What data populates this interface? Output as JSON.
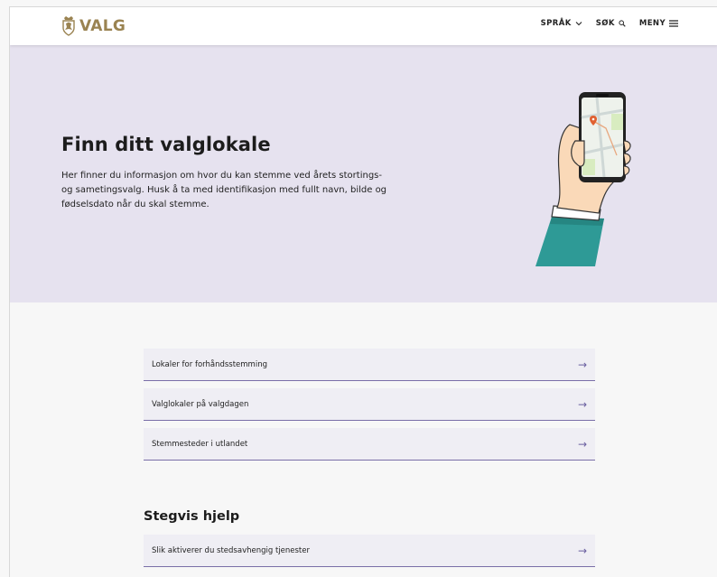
{
  "header": {
    "logo_text": "VALG",
    "nav": [
      {
        "label": "SPRÅK",
        "icon": "chevron-down-icon"
      },
      {
        "label": "SØK",
        "icon": "search-icon"
      },
      {
        "label": "MENY",
        "icon": "hamburger-icon"
      }
    ]
  },
  "hero": {
    "title": "Finn ditt valglokale",
    "text": "Her finner du informasjon om hvor du kan stemme ved årets stortings- og sametingsvalg. Husk å ta med identifikasjon med fullt navn, bilde og fødselsdato når du skal stemme."
  },
  "links": [
    {
      "label": "Lokaler for forhåndsstemming",
      "icon": "arrow-right-icon"
    },
    {
      "label": "Valglokaler på valgdagen",
      "icon": "arrow-right-icon"
    },
    {
      "label": "Stemmesteder i utlandet",
      "icon": "arrow-right-icon"
    }
  ],
  "help": {
    "title": "Stegvis hjelp",
    "links": [
      {
        "label": "Slik aktiverer du stedsavhengig tjenester",
        "icon": "arrow-right-icon"
      }
    ]
  },
  "colors": {
    "hero_bg": "#e6e2ef",
    "accent": "#6a5fa0",
    "logo": "#9a8351"
  }
}
